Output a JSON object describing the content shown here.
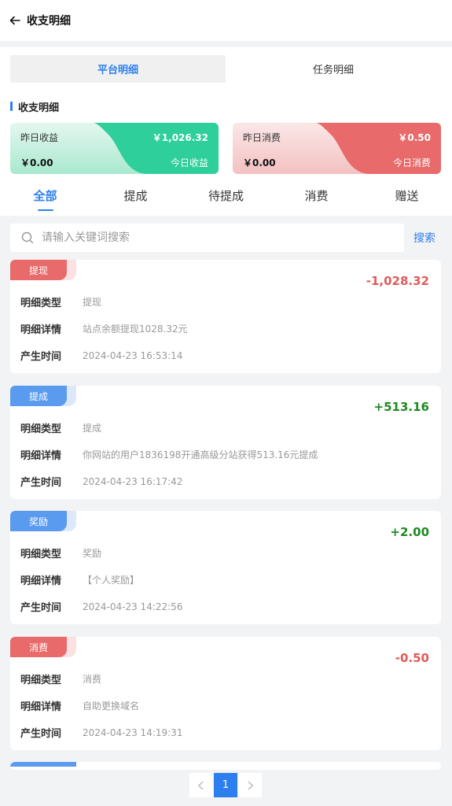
{
  "header": {
    "title": "收支明细"
  },
  "segments": [
    {
      "label": "平台明细",
      "active": true
    },
    {
      "label": "任务明细",
      "active": false
    }
  ],
  "section_title": "收支明细",
  "summary": {
    "income": {
      "yesterday_label": "昨日收益",
      "yesterday_value": "￥1,026.32",
      "today_value": "￥0.00",
      "today_label": "今日收益",
      "color": "#2ecf9a"
    },
    "expense": {
      "yesterday_label": "昨日消费",
      "yesterday_value": "￥0.50",
      "today_value": "￥0.00",
      "today_label": "今日消费",
      "color": "#e86a6a"
    }
  },
  "tabs": [
    "全部",
    "提成",
    "待提成",
    "消费",
    "赠送"
  ],
  "search": {
    "placeholder": "请输入关键词搜索",
    "button": "搜索"
  },
  "field_labels": {
    "type": "明细类型",
    "detail": "明细详情",
    "time": "产生时间"
  },
  "records": [
    {
      "tag": "提现",
      "tag_color": "#e86a6a",
      "amount": "-1,028.32",
      "amount_color": "#e05a5a",
      "type": "提现",
      "detail": "站点余额提现1028.32元",
      "time": "2024-04-23 16:53:14"
    },
    {
      "tag": "提成",
      "tag_color": "#5b9bef",
      "amount": "+513.16",
      "amount_color": "#1e8a1e",
      "type": "提成",
      "detail": "你网站的用户1836198开通高级分站获得513.16元提成",
      "time": "2024-04-23 16:17:42"
    },
    {
      "tag": "奖励",
      "tag_color": "#5b9bef",
      "amount": "+2.00",
      "amount_color": "#1e8a1e",
      "type": "奖励",
      "detail": "【个人奖励】",
      "time": "2024-04-23 14:22:56"
    },
    {
      "tag": "消费",
      "tag_color": "#e86a6a",
      "amount": "-0.50",
      "amount_color": "#e05a5a",
      "type": "消费",
      "detail": "自助更换域名",
      "time": "2024-04-23 14:19:31"
    }
  ],
  "pagination": {
    "current": "1",
    "prev_icon": "chevron-left-icon",
    "next_icon": "chevron-right-icon"
  }
}
